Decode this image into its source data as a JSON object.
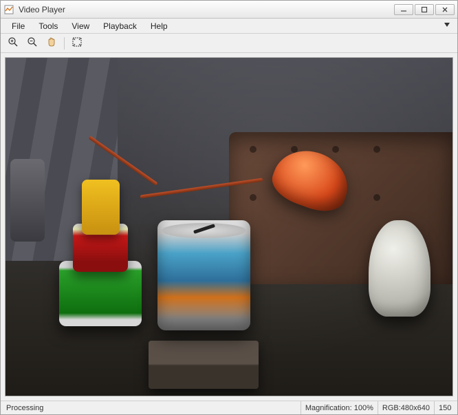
{
  "window": {
    "title": "Video Player"
  },
  "menu": {
    "file": "File",
    "tools": "Tools",
    "view": "View",
    "playback": "Playback",
    "help": "Help"
  },
  "toolbar": {
    "zoom_in": "zoom-in",
    "zoom_out": "zoom-out",
    "pan": "pan",
    "fit": "fit-to-window"
  },
  "status": {
    "state": "Processing",
    "magnification_label": "Magnification:",
    "magnification_value": "100%",
    "format": "RGB:480x640",
    "frame": "150"
  }
}
